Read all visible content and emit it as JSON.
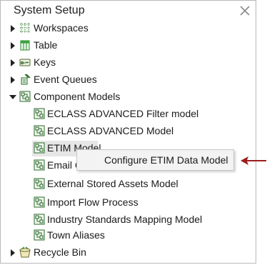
{
  "panel": {
    "title": "System Setup",
    "close_icon": "close-icon"
  },
  "tree": {
    "workspaces": {
      "label": "Workspaces",
      "icon": "workspaces-icon"
    },
    "table": {
      "label": "Table",
      "icon": "table-icon"
    },
    "keys": {
      "label": "Keys",
      "icon": "keys-icon"
    },
    "event_queues": {
      "label": "Event Queues",
      "icon": "event-queues-icon"
    },
    "component_models": {
      "label": "Component Models",
      "icon": "component-models-icon",
      "expanded": true,
      "children": [
        {
          "label": "ECLASS ADVANCED Filter model"
        },
        {
          "label": "ECLASS ADVANCED Model"
        },
        {
          "label": "ETIM Model"
        },
        {
          "label": "Email Configuration"
        },
        {
          "label": "External Stored Assets Model"
        },
        {
          "label": "Import Flow Process"
        },
        {
          "label": "Industry Standards Mapping Model"
        },
        {
          "label": "Town Aliases"
        }
      ]
    },
    "recycle_bin": {
      "label": "Recycle Bin",
      "icon": "recycle-bin-icon"
    }
  },
  "context_menu": {
    "item": "Configure ETIM Data Model"
  },
  "colors": {
    "annotation_arrow": "#9b1c1c",
    "selected_row": "#e6e6e6"
  }
}
